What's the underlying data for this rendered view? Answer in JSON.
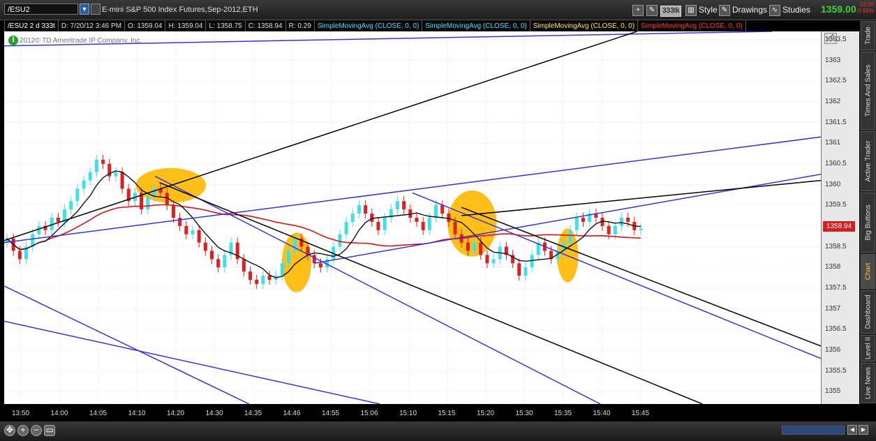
{
  "header": {
    "symbol": "/ESU2",
    "description": "E-mini S&P 500 Index Futures,Sep-2012,ETH",
    "aggregation_badge": "333tk",
    "style_label": "Style",
    "drawings_label": "Drawings",
    "studies_label": "Studies",
    "last_price": "1359.00",
    "change_abs": "-13.00",
    "change_pct": "-0.95%"
  },
  "infobar": {
    "symbol_period": "/ESU2 2 d 333t",
    "date": "D: 7/20/12 3:46 PM",
    "open": "O: 1359.04",
    "high": "H: 1359.04",
    "low": "L: 1358.75",
    "close": "C: 1358.94",
    "range": "R: 0.29",
    "studies": [
      {
        "label": "SimpleMovingAvg (CLOSE, 0, 0)",
        "color": "#4fd8ff"
      },
      {
        "label": "SimpleMovingAvg (CLOSE, 0, 0)",
        "color": "#4fd8ff"
      },
      {
        "label": "SimpleMovingAvg (CLOSE, 0, 0)",
        "color": "#ffe34d"
      },
      {
        "label": "SimpleMovingAvg (CLOSE, 0, 0)",
        "color": "#ff3030"
      }
    ]
  },
  "copyright": "2012© TD Ameritrade IP Company, Inc.",
  "side_tabs": [
    "Trade",
    "Times And Sales",
    "Active Trader",
    "Big Buttons",
    "Chart",
    "Dashboard",
    "Level II",
    "Live News"
  ],
  "active_tab": "Chart",
  "colors": {
    "up_bar": "#3fe0e8",
    "down_bar": "#e02020",
    "sma_fast": "#101010",
    "sma_slow": "#e01010",
    "trend_blue": "#3333dd",
    "trend_black": "#000000",
    "highlight": "#ffb800"
  },
  "chart_data": {
    "type": "candlestick",
    "title": "",
    "xlabel": "",
    "ylabel": "",
    "ylim": [
      1354.7,
      1363.7
    ],
    "y_ticks": [
      "1355",
      "1355.5",
      "1356",
      "1356.5",
      "1357",
      "1357.5",
      "1358",
      "1358.5",
      "1359",
      "1359.5",
      "1360",
      "1360.5",
      "1361",
      "1361.5",
      "1362",
      "1362.5",
      "1363",
      "1363.5"
    ],
    "x_ticks": [
      "13:50",
      "14:00",
      "14:05",
      "14:10",
      "14:20",
      "14:30",
      "14:35",
      "14:46",
      "14:55",
      "15:06",
      "15:10",
      "15:15",
      "15:20",
      "15:30",
      "15:35",
      "15:40",
      "15:45"
    ],
    "last_value": "1358.94",
    "closes": [
      1358.7,
      1358.4,
      1358.2,
      1358.5,
      1358.8,
      1359.0,
      1358.9,
      1359.2,
      1359.1,
      1359.4,
      1359.6,
      1359.9,
      1360.1,
      1360.3,
      1360.6,
      1360.5,
      1360.2,
      1360.3,
      1359.9,
      1359.6,
      1359.8,
      1359.4,
      1359.7,
      1359.9,
      1359.8,
      1359.5,
      1359.2,
      1359.0,
      1358.8,
      1358.9,
      1358.6,
      1358.4,
      1358.2,
      1358.0,
      1358.3,
      1358.6,
      1358.2,
      1357.9,
      1357.7,
      1357.6,
      1357.8,
      1357.7,
      1357.8,
      1358.1,
      1358.4,
      1358.7,
      1358.5,
      1358.3,
      1358.1,
      1358.0,
      1358.2,
      1358.5,
      1358.8,
      1359.1,
      1359.3,
      1359.5,
      1359.3,
      1359.1,
      1358.9,
      1359.2,
      1359.4,
      1359.6,
      1359.4,
      1359.2,
      1359.1,
      1358.9,
      1359.2,
      1359.5,
      1359.3,
      1359.1,
      1358.8,
      1358.6,
      1358.4,
      1358.6,
      1358.3,
      1358.1,
      1358.2,
      1358.5,
      1358.3,
      1358.1,
      1357.8,
      1358.0,
      1358.3,
      1358.6,
      1358.4,
      1358.2,
      1358.4,
      1358.6,
      1358.9,
      1359.2,
      1359.1,
      1359.3,
      1359.2,
      1359.0,
      1358.8,
      1359.0,
      1359.2,
      1359.1,
      1358.9,
      1358.94
    ],
    "highlights": [
      {
        "x_frac": 0.204,
        "price": 1359.98,
        "rx_frac": 0.043,
        "ry_price": 0.42
      },
      {
        "x_frac": 0.358,
        "price": 1358.12,
        "rx_frac": 0.018,
        "ry_price": 0.72
      },
      {
        "x_frac": 0.573,
        "price": 1359.06,
        "rx_frac": 0.03,
        "ry_price": 0.8
      },
      {
        "x_frac": 0.69,
        "price": 1358.29,
        "rx_frac": 0.013,
        "ry_price": 0.65
      }
    ],
    "trendlines": [
      {
        "color": "blue",
        "from": [
          0.0,
          1358.6
        ],
        "to": [
          1.0,
          1361.15
        ]
      },
      {
        "color": "blue",
        "from": [
          0.0,
          1363.35
        ],
        "to": [
          0.94,
          1363.7
        ]
      },
      {
        "color": "blue",
        "from": [
          0.38,
          1358.1
        ],
        "to": [
          1.0,
          1360.25
        ]
      },
      {
        "color": "blue",
        "from": [
          0.185,
          1360.2
        ],
        "to": [
          0.73,
          1354.7
        ]
      },
      {
        "color": "blue",
        "from": [
          0.5,
          1359.8
        ],
        "to": [
          1.0,
          1355.8
        ]
      },
      {
        "color": "blue",
        "from": [
          0.0,
          1357.55
        ],
        "to": [
          0.3,
          1354.7
        ]
      },
      {
        "color": "blue",
        "from": [
          0.0,
          1356.7
        ],
        "to": [
          0.46,
          1354.7
        ]
      },
      {
        "color": "black",
        "from": [
          0.0,
          1358.65
        ],
        "to": [
          0.775,
          1363.7
        ]
      },
      {
        "color": "black",
        "from": [
          0.56,
          1359.25
        ],
        "to": [
          1.0,
          1360.1
        ]
      },
      {
        "color": "black",
        "from": [
          0.19,
          1360.05
        ],
        "to": [
          0.855,
          1354.7
        ]
      },
      {
        "color": "black",
        "from": [
          0.56,
          1359.45
        ],
        "to": [
          1.0,
          1356.1
        ]
      }
    ]
  }
}
